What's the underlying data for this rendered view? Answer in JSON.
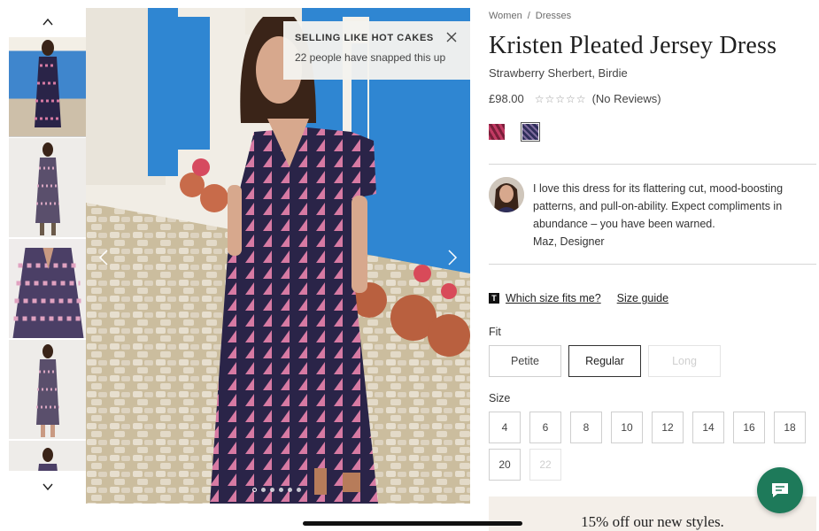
{
  "thumbnails": {
    "up_icon": "chevron-up-icon",
    "down_icon": "chevron-down-icon",
    "count": 5
  },
  "hero": {
    "toast": {
      "title": "SELLING LIKE HOT CAKES",
      "text": "22 people have snapped this up",
      "close_icon": "close-icon"
    },
    "prev_icon": "chevron-left-icon",
    "next_icon": "chevron-right-icon",
    "slide_count": 6,
    "active_slide": 1
  },
  "product": {
    "breadcrumb": [
      "Women",
      "Dresses"
    ],
    "breadcrumb_separator": "/",
    "title": "Kristen Pleated Jersey Dress",
    "colour": "Strawberry Sherbert, Birdie",
    "price": "£98.00",
    "stars": "☆☆☆☆☆",
    "reviews": "(No Reviews)",
    "swatch_colors": [
      "#c23a63",
      "#2f2e5a"
    ]
  },
  "designer_quote": {
    "text": "I love this dress for its flattering cut, mood-boosting patterns, and pull-on-ability. Expect compliments in abundance – you have been warned.",
    "author": "Maz, Designer"
  },
  "fit_links": {
    "badge": "T",
    "which_size": "Which size fits me?",
    "size_guide": "Size guide"
  },
  "fit": {
    "label": "Fit",
    "options": [
      "Petite",
      "Regular",
      "Long"
    ],
    "selected": "Regular",
    "unavailable": [
      "Long"
    ]
  },
  "size": {
    "label": "Size",
    "options": [
      "4",
      "6",
      "8",
      "10",
      "12",
      "14",
      "16",
      "18",
      "20",
      "22"
    ],
    "unavailable": [
      "22"
    ]
  },
  "promo": {
    "text": "15% off our new styles."
  },
  "chat": {
    "icon": "chat-bubble-icon"
  },
  "colors": {
    "chat_button": "#1e7a5a",
    "dress_dark": "#2a2448",
    "dress_pink": "#d77aa3",
    "wall_blue": "#2f86d2"
  }
}
